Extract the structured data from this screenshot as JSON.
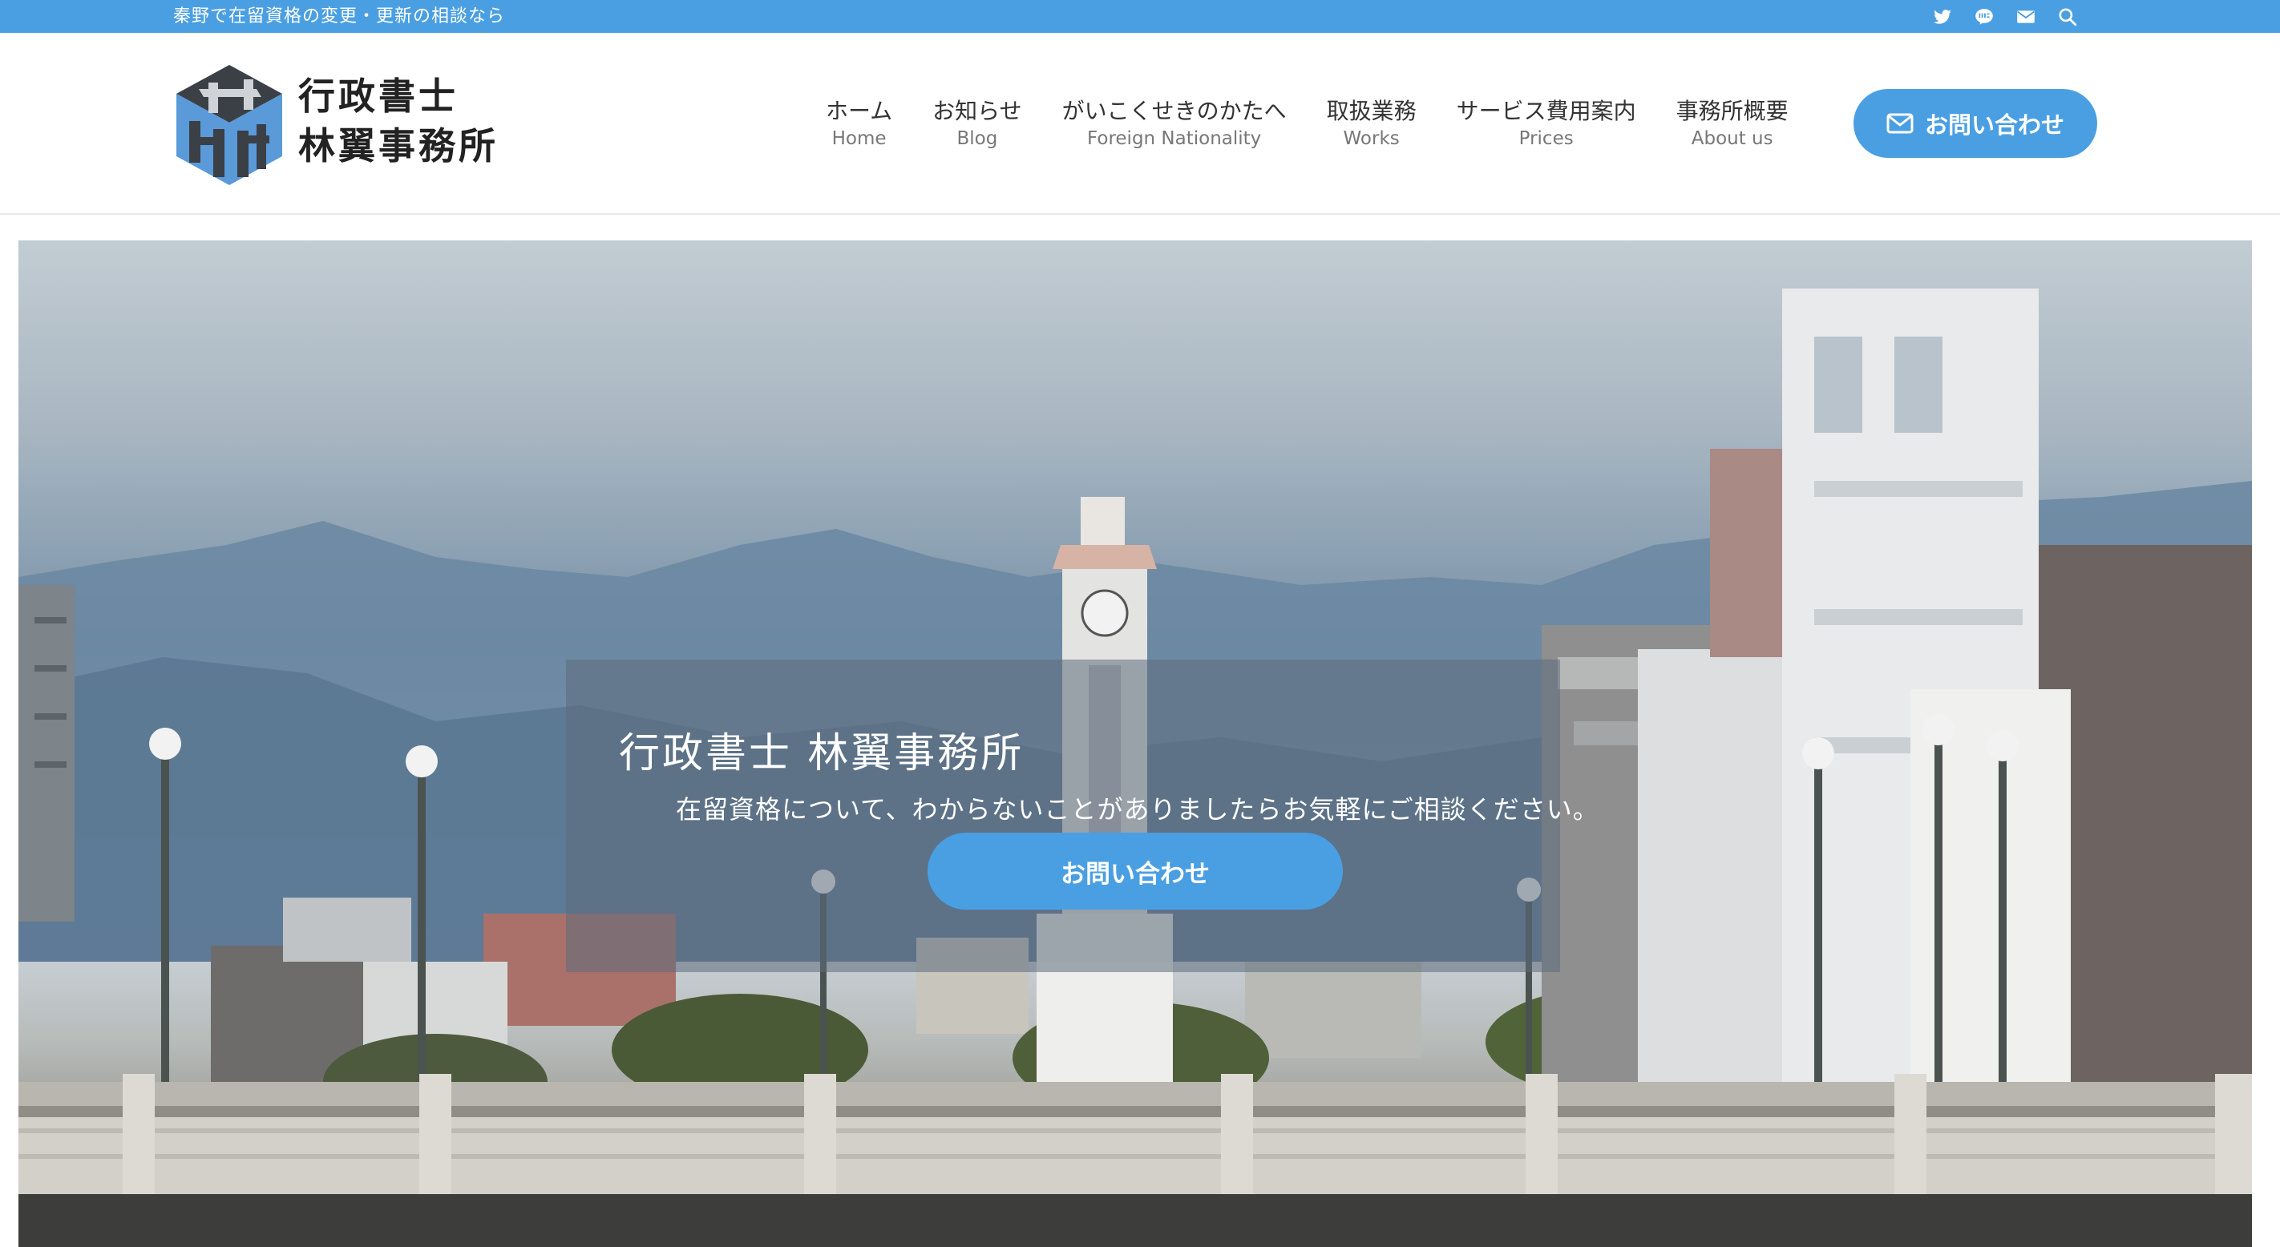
{
  "topbar": {
    "tagline": "秦野で在留資格の変更・更新の相談なら",
    "icons": [
      "twitter-icon",
      "line-icon",
      "mail-icon",
      "search-icon"
    ]
  },
  "header": {
    "logo_line1": "行政書士",
    "logo_line2": "林翼事務所",
    "nav": [
      {
        "jp": "ホーム",
        "en": "Home"
      },
      {
        "jp": "お知らせ",
        "en": "Blog"
      },
      {
        "jp": "がいこくせきのかたへ",
        "en": "Foreign Nationality"
      },
      {
        "jp": "取扱業務",
        "en": "Works"
      },
      {
        "jp": "サービス費用案内",
        "en": "Prices"
      },
      {
        "jp": "事務所概要",
        "en": "About us"
      }
    ],
    "contact_label": "お問い合わせ"
  },
  "hero": {
    "title": "行政書士 林翼事務所",
    "subtitle": "在留資格について、わからないことがありましたらお気軽にご相談ください。",
    "button_label": "お問い合わせ"
  },
  "colors": {
    "accent": "#4a9fe2",
    "logo_blue": "#5a9ad9",
    "logo_dark": "#3b3f46"
  }
}
